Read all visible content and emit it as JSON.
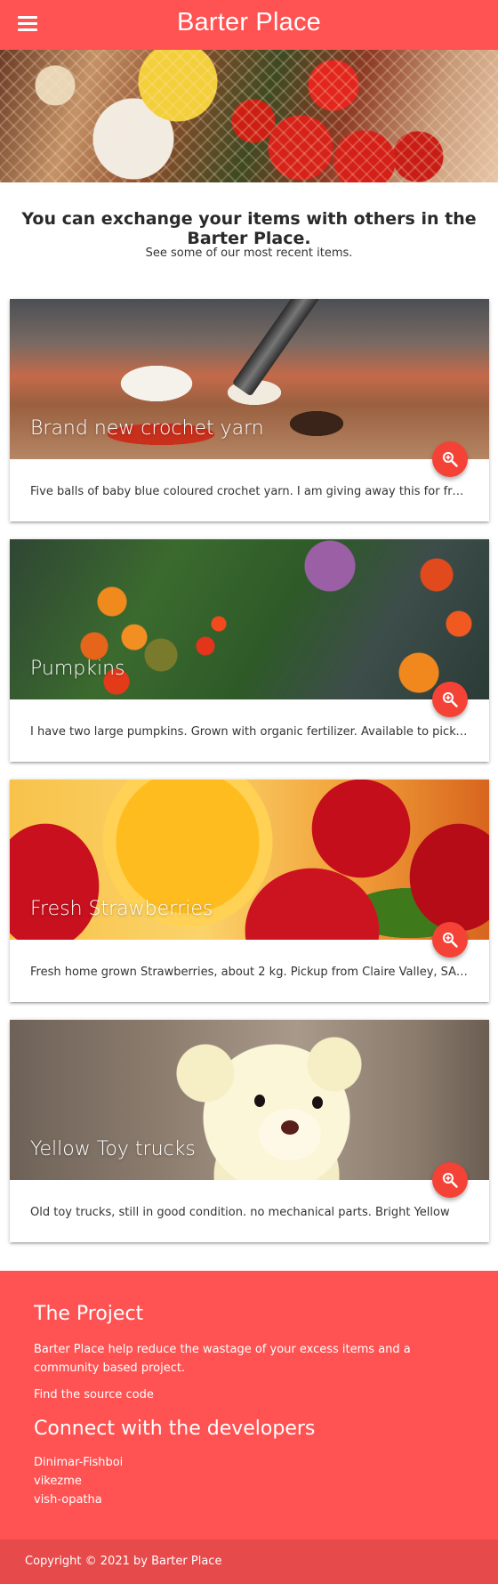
{
  "nav": {
    "brand": "Barter Place",
    "menu_icon": "hamburger-icon"
  },
  "intro": {
    "title": "You can exchange your items with others in the Barter Place.",
    "subtitle": "See some of our most recent items."
  },
  "items": [
    {
      "title": "Brand new crochet yarn",
      "description": "Five balls of baby blue coloured crochet yarn. I am giving away this for free. Any",
      "action_icon": "zoom-in-icon"
    },
    {
      "title": "Pumpkins",
      "description": "I have two large pumpkins. Grown with organic fertilizer. Available to pickup on weekends",
      "action_icon": "zoom-in-icon"
    },
    {
      "title": "Fresh Strawberries",
      "description": "Fresh home grown Strawberries, about 2 kg. Pickup from Claire Valley, SA. Pickup anytime",
      "action_icon": "zoom-in-icon"
    },
    {
      "title": "Yellow Toy trucks",
      "description": "Old toy trucks, still in good condition. no mechanical parts. Bright Yellow",
      "action_icon": "zoom-in-icon"
    }
  ],
  "footer": {
    "project_heading": "The Project",
    "project_text": "Barter Place help reduce the wastage of your excess items and a community based project.",
    "source_link": "Find the source code",
    "developers_heading": "Connect with the developers",
    "developers": [
      "Dinimar-Fishboi",
      "vikezme",
      "vish-opatha"
    ],
    "copyright": "Copyright © 2021 by Barter Place"
  },
  "colors": {
    "primary": "#ff5252",
    "fab": "#f44336",
    "footer_bottom": "#e64a4a"
  }
}
